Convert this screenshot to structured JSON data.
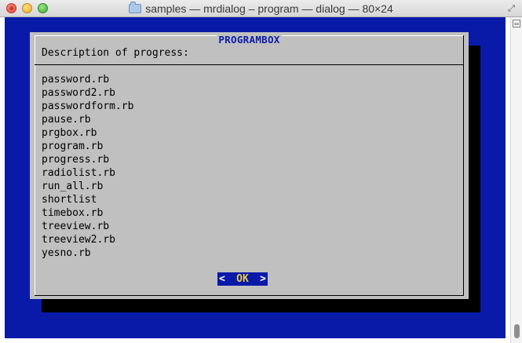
{
  "window": {
    "title": "samples — mrdialog – program — dialog — 80×24",
    "fullscreen_glyph": "⤢"
  },
  "dialog": {
    "title": "PROGRAMBOX",
    "description": "Description of progress:",
    "output_lines": [
      "password.rb",
      "password2.rb",
      "passwordform.rb",
      "pause.rb",
      "prgbox.rb",
      "program.rb",
      "progress.rb",
      "radiolist.rb",
      "run_all.rb",
      "shortlist",
      "timebox.rb",
      "treeview.rb",
      "treeview2.rb",
      "yesno.rb"
    ],
    "ok_button": {
      "left_bracket": "<",
      "hotkey": "O",
      "rest": "K",
      "right_bracket": ">"
    }
  },
  "colors": {
    "terminal_background": "#0a1aa8",
    "dialog_background": "#c0c0c0",
    "dialog_title": "#0a1aa8",
    "button_background": "#0a1aa8",
    "button_hotkey": "#e8c84a",
    "shadow": "#000000"
  },
  "icons": [
    "close-icon",
    "minimize-icon",
    "zoom-icon",
    "folder-icon",
    "fullscreen-icon",
    "scrollbar-lines-icon"
  ]
}
